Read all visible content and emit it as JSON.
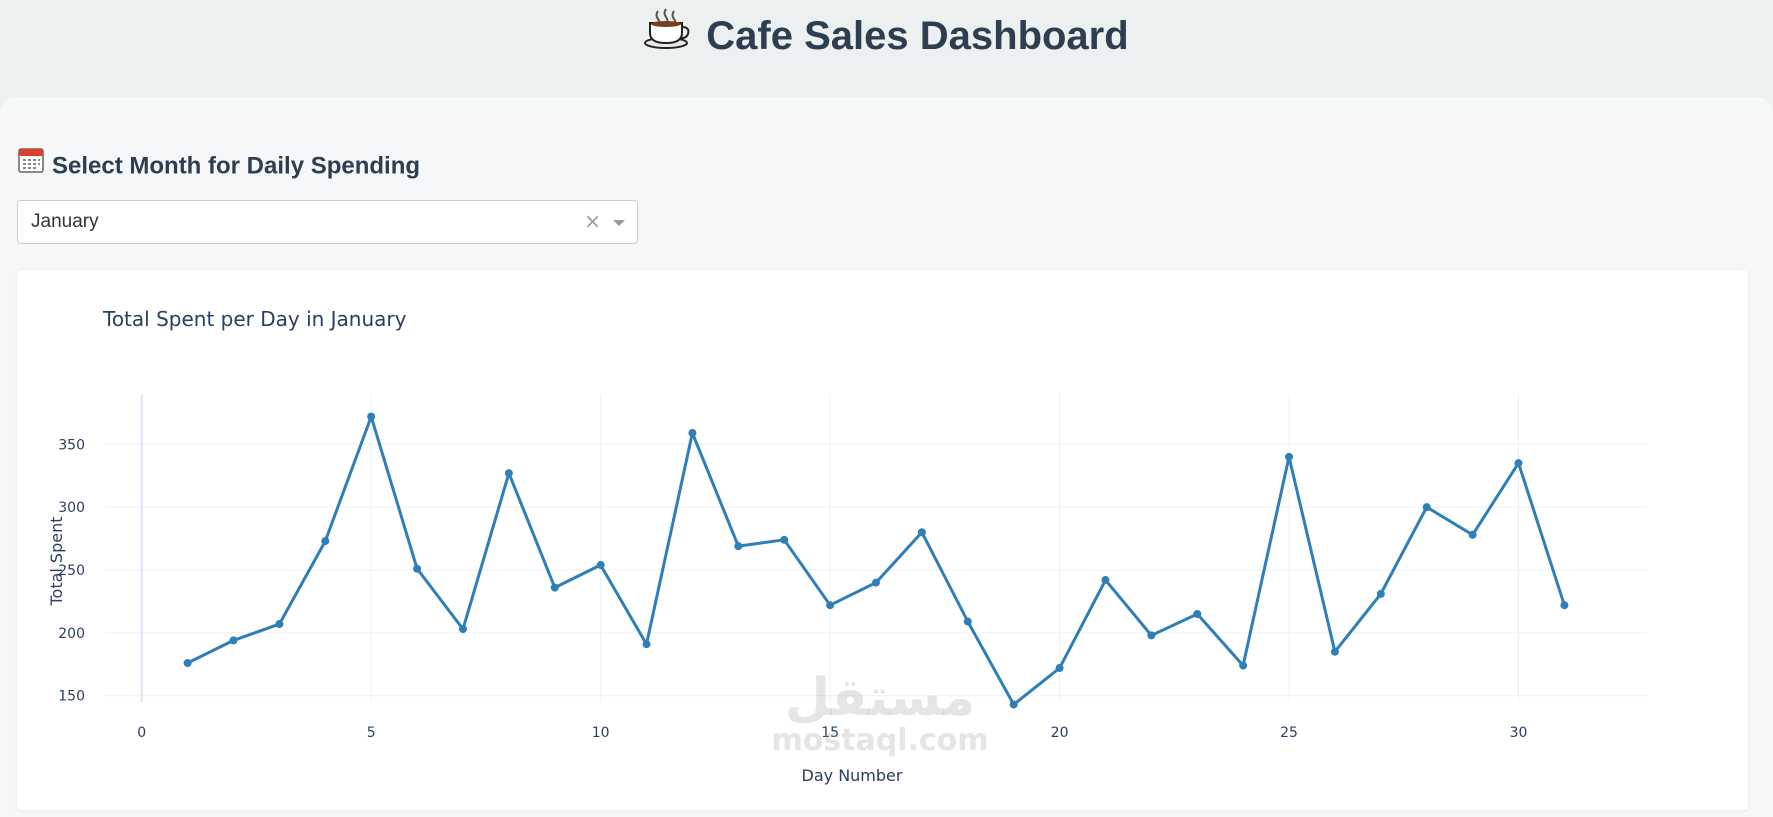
{
  "header": {
    "title": "Cafe Sales Dashboard",
    "icon": "coffee-cup-icon"
  },
  "controls": {
    "month_label": "Select Month for Daily Spending",
    "month_icon": "calendar-icon",
    "month_dropdown": {
      "selected": "January",
      "clear_symbol": "×"
    }
  },
  "watermark": {
    "arabic": "مستقل",
    "latin": "mostaql.com"
  },
  "chart_data": {
    "type": "line",
    "title": "Total Spent per Day in January",
    "xlabel": "Day Number",
    "ylabel": "Total Spent",
    "xlim": [
      -0.8,
      32.8
    ],
    "ylim": [
      145,
      390
    ],
    "xticks": [
      0,
      5,
      10,
      15,
      20,
      25,
      30
    ],
    "yticks": [
      150,
      200,
      250,
      300,
      350
    ],
    "grid": true,
    "line_color": "#2e7eb8",
    "series": [
      {
        "x": [
          1,
          2,
          3,
          4,
          5,
          6,
          7,
          8,
          9,
          10,
          11,
          12,
          13,
          14,
          15,
          16,
          17,
          18,
          19,
          20,
          21,
          22,
          23,
          24,
          25,
          26,
          27,
          28,
          29,
          30,
          31
        ],
        "y": [
          176,
          194,
          207,
          273,
          372,
          251,
          203,
          327,
          236,
          254,
          191,
          359,
          269,
          274,
          222,
          240,
          280,
          209,
          143,
          172,
          242,
          198,
          215,
          174,
          340,
          185,
          231,
          300,
          278,
          335,
          222
        ]
      }
    ]
  }
}
